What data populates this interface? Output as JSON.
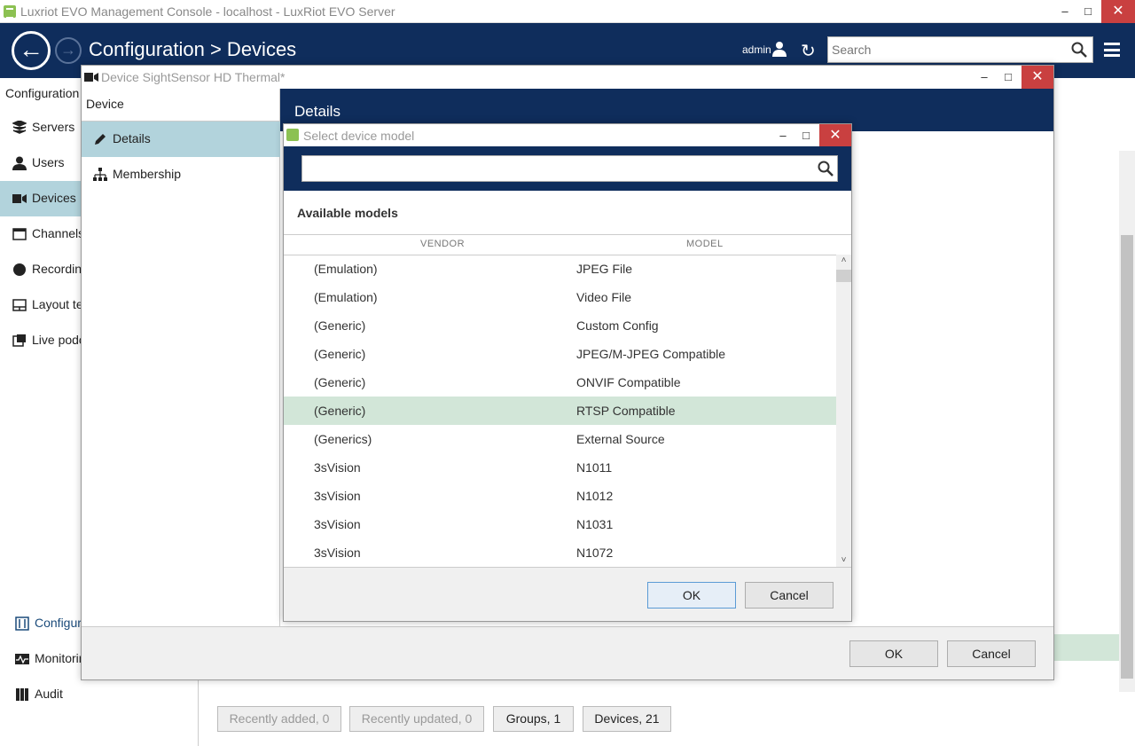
{
  "window": {
    "title": "Luxriot EVO Management Console - localhost - LuxRiot EVO Server",
    "caption_minimize": "–",
    "caption_maximize": "□",
    "caption_close": "✕"
  },
  "header": {
    "breadcrumb": "Configuration > Devices",
    "user": "admin",
    "search_placeholder": "Search"
  },
  "sidebar": {
    "title": "Configuration",
    "items": [
      {
        "label": "Servers",
        "icon": "servers-icon"
      },
      {
        "label": "Users",
        "icon": "user-icon"
      },
      {
        "label": "Devices",
        "icon": "camera-icon",
        "active": true
      },
      {
        "label": "Channels",
        "icon": "channels-icon"
      },
      {
        "label": "Recording",
        "icon": "record-icon"
      },
      {
        "label": "Layout templates",
        "icon": "layout-icon"
      },
      {
        "label": "Live podcasts",
        "icon": "podcast-icon"
      }
    ],
    "bottom_items": [
      {
        "label": "Configuration",
        "icon": "config-icon"
      },
      {
        "label": "Monitoring",
        "icon": "monitoring-icon"
      },
      {
        "label": "Audit",
        "icon": "audit-icon"
      }
    ]
  },
  "bottom_tabs": {
    "recently_added": "Recently added, 0",
    "recently_updated": "Recently updated, 0",
    "groups": "Groups, 1",
    "devices": "Devices, 21"
  },
  "device_window": {
    "title": "Device SightSensor HD Thermal*",
    "left_header": "Device",
    "nav": [
      {
        "label": "Details",
        "icon": "pencil-icon",
        "active": true
      },
      {
        "label": "Membership",
        "icon": "hierarchy-icon"
      }
    ],
    "details_header": "Details",
    "ok": "OK",
    "cancel": "Cancel"
  },
  "select_dialog": {
    "title": "Select device model",
    "search_value": "",
    "available_title": "Available models",
    "col_vendor": "VENDOR",
    "col_model": "MODEL",
    "rows": [
      {
        "vendor": "(Emulation)",
        "model": "JPEG File"
      },
      {
        "vendor": "(Emulation)",
        "model": "Video File"
      },
      {
        "vendor": "(Generic)",
        "model": "Custom Config"
      },
      {
        "vendor": "(Generic)",
        "model": "JPEG/M-JPEG Compatible"
      },
      {
        "vendor": "(Generic)",
        "model": "ONVIF Compatible"
      },
      {
        "vendor": "(Generic)",
        "model": "RTSP Compatible",
        "selected": true
      },
      {
        "vendor": "(Generics)",
        "model": "External Source"
      },
      {
        "vendor": "3sVision",
        "model": "N1011"
      },
      {
        "vendor": "3sVision",
        "model": "N1012"
      },
      {
        "vendor": "3sVision",
        "model": "N1031"
      },
      {
        "vendor": "3sVision",
        "model": "N1072"
      }
    ],
    "ok": "OK",
    "cancel": "Cancel"
  },
  "colors": {
    "header_bg": "#0f2d5c",
    "active_nav": "#b2d3dc",
    "selected_row": "#d2e6d8",
    "close_button": "#c94040",
    "app_icon": "#8cc152"
  }
}
